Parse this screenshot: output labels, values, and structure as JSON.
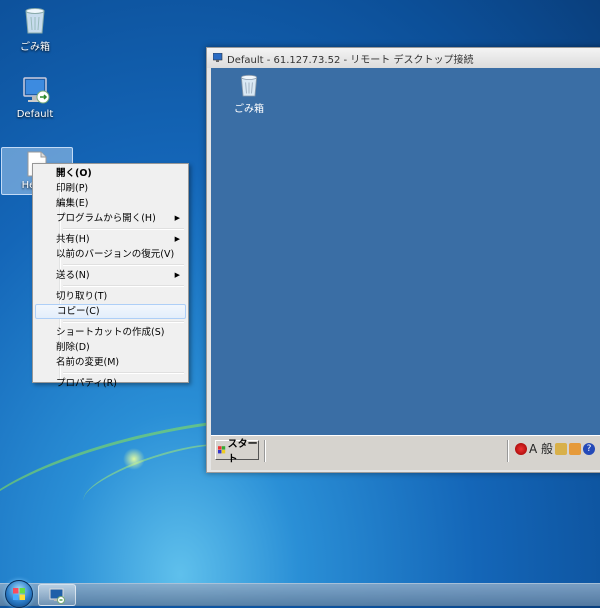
{
  "desktop": {
    "icons": [
      {
        "label": "ごみ箱",
        "icon": "recycle-bin-icon"
      },
      {
        "label": "Default",
        "icon": "remote-desktop-shortcut-icon"
      },
      {
        "label": "Helow",
        "icon": "text-document-icon"
      }
    ]
  },
  "remote_window": {
    "title": "Default - 61.127.73.52 - リモート デスクトップ接続",
    "inner_desktop": {
      "icons": [
        {
          "label": "ごみ箱",
          "icon": "recycle-bin-icon"
        }
      ]
    },
    "inner_taskbar": {
      "start_label": "スタート",
      "tray_text": "A 般"
    }
  },
  "context_menu": {
    "items": [
      {
        "label": "開く(O)",
        "bold": true
      },
      {
        "label": "印刷(P)"
      },
      {
        "label": "編集(E)"
      },
      {
        "label": "プログラムから開く(H)",
        "submenu": true
      },
      {
        "separator": true
      },
      {
        "label": "共有(H)",
        "submenu": true
      },
      {
        "label": "以前のバージョンの復元(V)"
      },
      {
        "separator": true
      },
      {
        "label": "送る(N)",
        "submenu": true
      },
      {
        "separator": true
      },
      {
        "label": "切り取り(T)"
      },
      {
        "label": "コピー(C)",
        "hover": true
      },
      {
        "separator": true
      },
      {
        "label": "ショートカットの作成(S)"
      },
      {
        "label": "削除(D)"
      },
      {
        "label": "名前の変更(M)"
      },
      {
        "separator": true
      },
      {
        "label": "プロパティ(R)"
      }
    ]
  },
  "taskbar": {
    "start_icon": "windows-orb-icon",
    "pinned": [
      {
        "icon": "remote-desktop-icon"
      }
    ]
  }
}
